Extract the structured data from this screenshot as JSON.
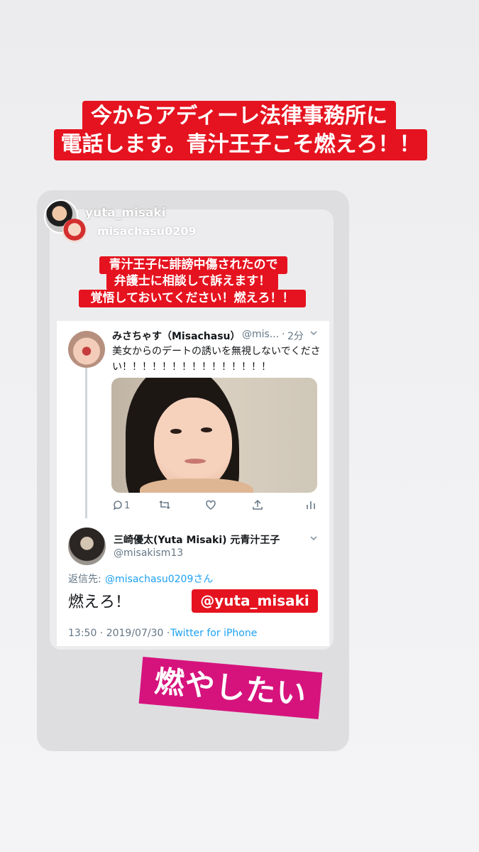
{
  "caption": {
    "line1": "今からアディーレ法律事務所に",
    "line2": "電話します。青汁王子こそ燃えろ！！"
  },
  "story": {
    "username": "yuta_misaki",
    "inner_username": "misachasu0209",
    "inner_caption": {
      "line1": "青汁王子に誹謗中傷されたので",
      "line2": "弁護士に相談して訴えます！",
      "line3": "覚悟しておいてください！燃えろ！！"
    }
  },
  "tweet1": {
    "name": "みさちゃす（Misachasu）",
    "handle": "@mis...",
    "separator": "·",
    "time": "2分",
    "text": "美女からのデートの誘いを無視しないでください！！！！！！！！！！！！！！！",
    "reply_count": "1"
  },
  "tweet2": {
    "name": "三崎優太(Yuta Misaki) 元青汁王子",
    "handle": "@misakism13",
    "reply_to_label": "返信先:",
    "reply_to_target": "@misachasu0209さん",
    "text": "燃えろ！",
    "timestamp": "13:50 · 2019/07/30 · ",
    "source": "Twitter for iPhone"
  },
  "sticker_mention": "@yuta_misaki",
  "sticker_text": "燃やしたい",
  "icons": {
    "reply": "reply-icon",
    "retweet": "retweet-icon",
    "like": "heart-icon",
    "share": "share-icon",
    "analytics": "analytics-icon",
    "chevron": "chevron-down-icon"
  },
  "colors": {
    "caption_red": "#e5131f",
    "sticker_pink": "#d6137d",
    "link_blue": "#1da1f2"
  }
}
